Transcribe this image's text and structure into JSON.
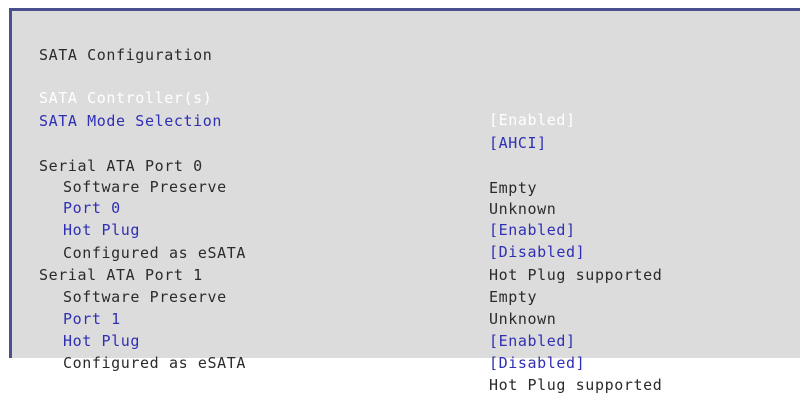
{
  "section_title": "SATA Configuration",
  "controller": {
    "label": "SATA Controller(s)",
    "value": "[Enabled]"
  },
  "mode": {
    "label": "SATA Mode Selection",
    "value": "[AHCI]"
  },
  "port0": {
    "label": "Serial ATA Port 0",
    "status": "Empty",
    "software_preserve_label": "Software Preserve",
    "software_preserve_value": "Unknown",
    "port_label": "Port 0",
    "port_value": "[Enabled]",
    "hotplug_label": "Hot Plug",
    "hotplug_value": "[Disabled]",
    "esata_label": "Configured as eSATA",
    "esata_value": "Hot Plug supported"
  },
  "port1": {
    "label": "Serial ATA Port 1",
    "status": "Empty",
    "software_preserve_label": "Software Preserve",
    "software_preserve_value": "Unknown",
    "port_label": "Port 1",
    "port_value": "[Enabled]",
    "hotplug_label": "Hot Plug",
    "hotplug_value": "[Disabled]",
    "esata_label": "Configured as eSATA",
    "esata_value": "Hot Plug supported"
  },
  "colors": {
    "panel_background": "#dcdcdc",
    "frame_border": "#4a4f8f",
    "static_text": "#2b2b2b",
    "selectable_text": "#2f2fb4",
    "highlighted_text": "#ffffff"
  }
}
